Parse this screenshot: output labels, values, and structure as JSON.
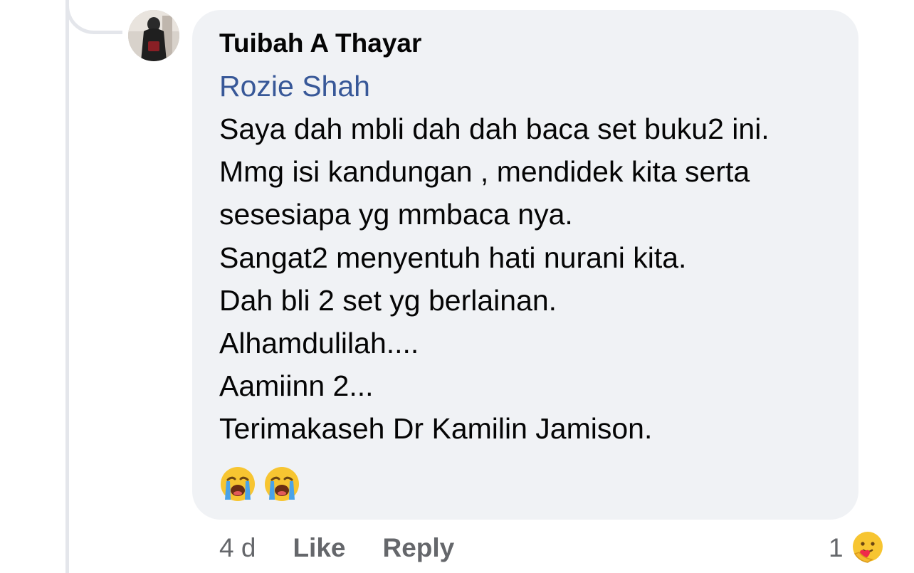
{
  "comment": {
    "author": "Tuibah A Thayar",
    "mention": "Rozie Shah",
    "lines": [
      "Saya dah mbli dah dah baca set buku2 ini.",
      "Mmg isi kandungan , mendidek kita serta",
      "sesesiapa yg mmbaca nya.",
      "Sangat2 menyentuh hati nurani kita.",
      "Dah bli 2 set yg berlainan.",
      "Alhamdulilah....",
      "Aamiinn 2...",
      "Terimakaseh Dr Kamilin Jamison."
    ],
    "emojis": [
      "loudly-crying-face-icon",
      "loudly-crying-face-icon"
    ]
  },
  "footer": {
    "time": "4 d",
    "like_label": "Like",
    "reply_label": "Reply"
  },
  "reactions": {
    "count": "1",
    "icon": "care-reaction-icon"
  },
  "colors": {
    "bubble": "#f0f2f5",
    "mention": "#385898",
    "text": "#050505",
    "muted": "#65676b"
  }
}
